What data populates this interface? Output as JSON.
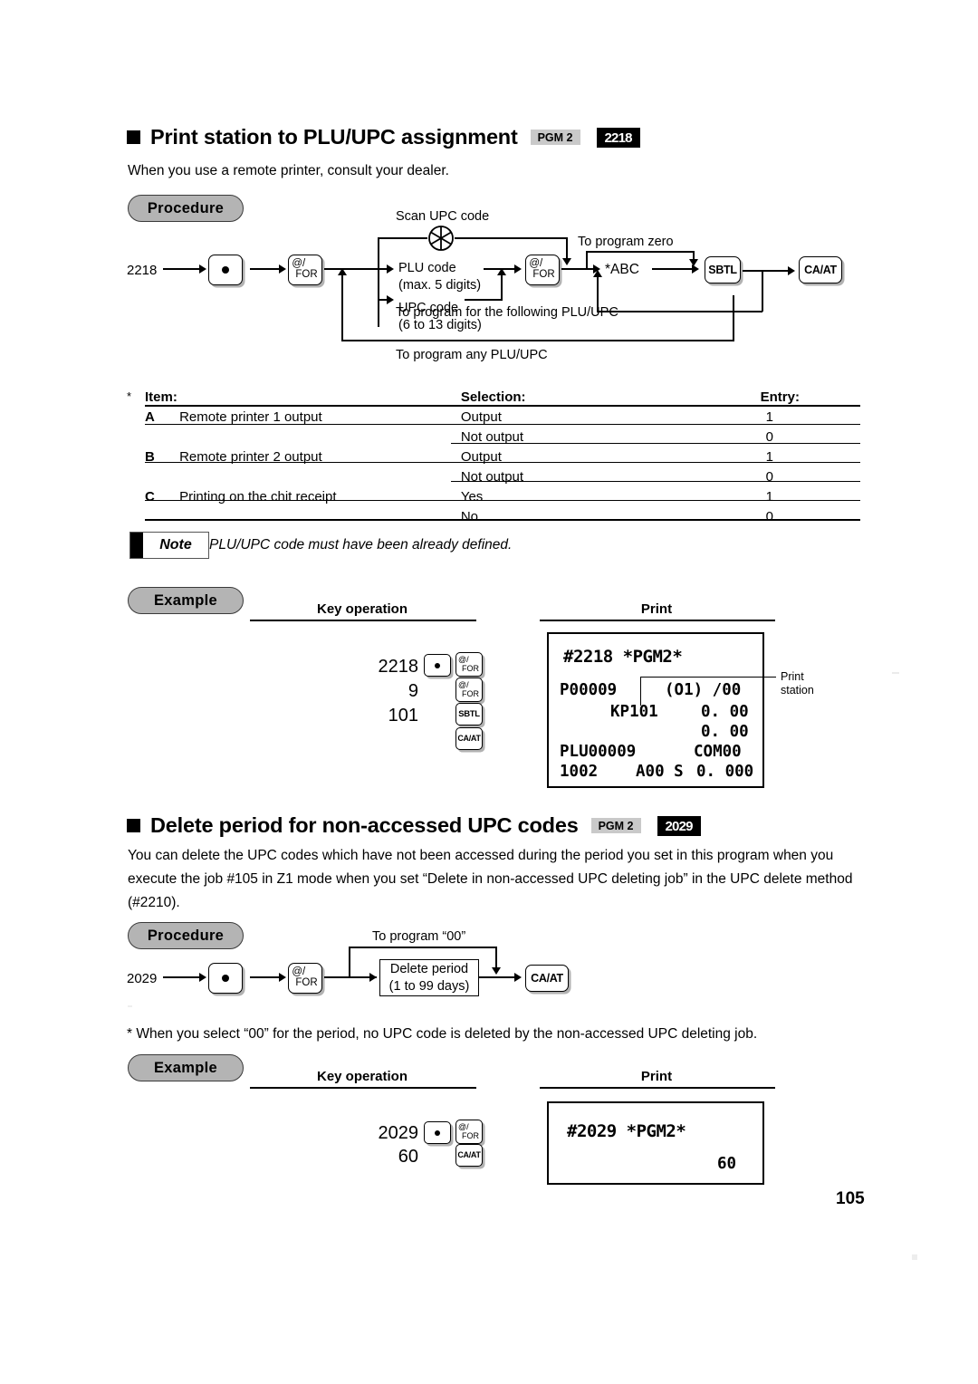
{
  "page": {
    "number": "105"
  },
  "section1": {
    "title": "Print station to PLU/UPC assignment",
    "pgm_tag": "PGM 2",
    "code_tag": "2218",
    "intro": "When you use a remote printer, consult your dealer.",
    "procedure_label": "Procedure",
    "flow": {
      "start_code": "2218",
      "dot_key": "●",
      "for_key_at": "@/",
      "for_key_for": "FOR",
      "scan_label": "Scan UPC code",
      "plu_line1": "PLU code",
      "plu_line2": "(max. 5 digits)",
      "upc_line1": "UPC code",
      "upc_line2": "(6 to 13 digits)",
      "to_program_zero": "To program zero",
      "abc_label": "*ABC",
      "sbtl_key": "SBTL",
      "caat_key": "CA/AT",
      "to_program_following": "To program for the following PLU/UPC",
      "to_program_any": "To program any PLU/UPC"
    },
    "table": {
      "star": "*",
      "headers": [
        "Item:",
        "Selection:",
        "Entry:"
      ],
      "rows": [
        {
          "item": "A",
          "desc": "Remote printer 1 output",
          "selection": "Output",
          "entry": "1"
        },
        {
          "item": "",
          "desc": "",
          "selection": "Not output",
          "entry": "0"
        },
        {
          "item": "B",
          "desc": "Remote printer 2 output",
          "selection": "Output",
          "entry": "1"
        },
        {
          "item": "",
          "desc": "",
          "selection": "Not output",
          "entry": "0"
        },
        {
          "item": "C",
          "desc": "Printing on the chit receipt",
          "selection": "Yes",
          "entry": "1"
        },
        {
          "item": "",
          "desc": "",
          "selection": "No",
          "entry": "0"
        }
      ]
    },
    "note": {
      "label": "Note",
      "text": "PLU/UPC code must have been already defined."
    },
    "example": {
      "label": "Example",
      "key_operation_header": "Key operation",
      "print_header": "Print",
      "keys": {
        "line1_num": "2218",
        "line2_num": "9",
        "line3_num": "101",
        "dot": "●",
        "for_at": "@/",
        "for_for": "FOR",
        "sbtl": "SBTL",
        "caat": "CA/AT"
      },
      "receipt": {
        "l1": "#2218 *PGM2*",
        "l2_left": "P00009",
        "l2_right": "(O1) /00",
        "l3_left": "KP101",
        "l3_right": "0. 00",
        "l4_right": "0. 00",
        "l5_left": "PLU00009",
        "l5_right": "COM00",
        "l6_a": "1002",
        "l6_b": "A00 S",
        "l6_c": "0. 000"
      },
      "callout": "Print\nstation",
      "callout_l1": "Print",
      "callout_l2": "station"
    }
  },
  "section2": {
    "title": "Delete period for non-accessed UPC codes",
    "pgm_tag": "PGM 2",
    "code_tag": "2029",
    "body": "You can delete the UPC codes which have not been accessed during the period you set in this program when you execute the job #105 in Z1 mode when you set “Delete in non-accessed UPC deleting job” in the UPC delete method (#2210).",
    "procedure_label": "Procedure",
    "flow": {
      "start_code": "2029",
      "dot_key": "●",
      "for_key_at": "@/",
      "for_key_for": "FOR",
      "to_program_00": "To program “00”",
      "box_line1": "Delete period",
      "box_line2": "(1 to 99 days)",
      "caat_key": "CA/AT"
    },
    "footnote": "* When you select “00” for the period, no UPC code is deleted by the non-accessed UPC deleting job.",
    "example": {
      "label": "Example",
      "key_operation_header": "Key operation",
      "print_header": "Print",
      "keys": {
        "line1_num": "2029",
        "line2_num": "60",
        "dot": "●",
        "for_at": "@/",
        "for_for": "FOR",
        "caat": "CA/AT"
      },
      "receipt": {
        "l1": "#2029 *PGM2*",
        "l2": "60"
      }
    }
  }
}
